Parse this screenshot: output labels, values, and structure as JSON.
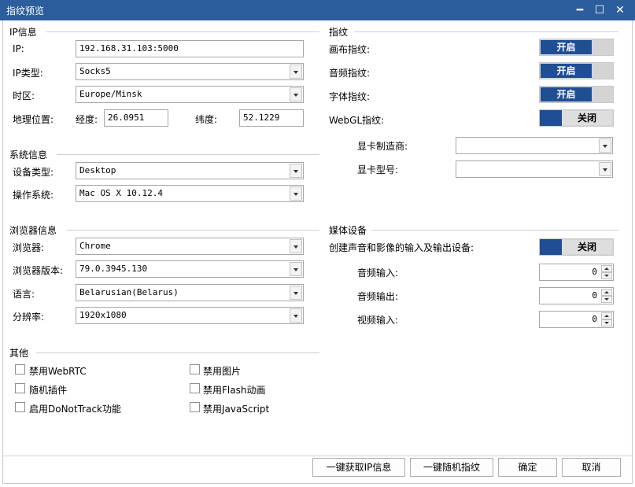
{
  "window": {
    "title": "指纹预览",
    "minimize": "━",
    "maximize": "☐",
    "close": "✕"
  },
  "ip_section": {
    "title": "IP信息",
    "ip_label": "IP:",
    "ip_value": "192.168.31.103:5000",
    "ip_type_label": "IP类型:",
    "ip_type_value": "Socks5",
    "timezone_label": "时区:",
    "timezone_value": "Europe/Minsk",
    "geo_label": "地理位置:",
    "lon_label": "经度:",
    "lon_value": "26.0951",
    "lat_label": "纬度:",
    "lat_value": "52.1229"
  },
  "system_section": {
    "title": "系统信息",
    "device_label": "设备类型:",
    "device_value": "Desktop",
    "os_label": "操作系统:",
    "os_value": "Mac OS X 10.12.4"
  },
  "browser_section": {
    "title": "浏览器信息",
    "browser_label": "浏览器:",
    "browser_value": "Chrome",
    "version_label": "浏览器版本:",
    "version_value": "79.0.3945.130",
    "language_label": "语言:",
    "language_value": "Belarusian(Belarus)",
    "resolution_label": "分辨率:",
    "resolution_value": "1920x1080"
  },
  "other_section": {
    "title": "其他",
    "options": [
      {
        "label": "禁用WebRTC",
        "checked": false
      },
      {
        "label": "随机插件",
        "checked": false
      },
      {
        "label": "启用DoNotTrack功能",
        "checked": false
      },
      {
        "label": "禁用图片",
        "checked": false
      },
      {
        "label": "禁用Flash动画",
        "checked": false
      },
      {
        "label": "禁用JavaScript",
        "checked": false
      }
    ]
  },
  "fingerprint_section": {
    "title": "指纹",
    "canvas_label": "画布指纹:",
    "canvas_state": "开启",
    "audio_label": "音频指纹:",
    "audio_state": "开启",
    "font_label": "字体指纹:",
    "font_state": "开启",
    "webgl_label": "WebGL指纹:",
    "webgl_state": "关闭",
    "gpu_vendor_label": "显卡制造商:",
    "gpu_vendor_value": "",
    "gpu_model_label": "显卡型号:",
    "gpu_model_value": ""
  },
  "media_section": {
    "title": "媒体设备",
    "create_label": "创建声音和影像的输入及输出设备:",
    "create_state": "关闭",
    "audio_in_label": "音频输入:",
    "audio_in_value": "0",
    "audio_out_label": "音频输出:",
    "audio_out_value": "0",
    "video_in_label": "视频输入:",
    "video_in_value": "0"
  },
  "buttons": {
    "get_ip": "一键获取IP信息",
    "random_fp": "一键随机指纹",
    "ok": "确定",
    "cancel": "取消"
  },
  "colors": {
    "titlebar": "#2c5d9c",
    "toggle_on": "#1f4e93"
  }
}
